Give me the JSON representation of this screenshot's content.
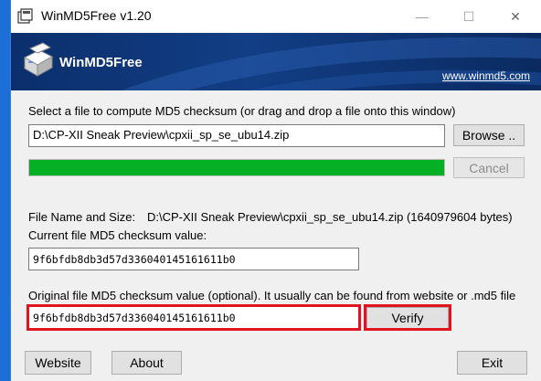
{
  "window": {
    "title": "WinMD5Free v1.20",
    "controls": {
      "minimize": "—",
      "maximize": "☐",
      "close": "✕"
    }
  },
  "banner": {
    "title": "WinMD5Free",
    "link": "www.winmd5.com"
  },
  "file_section": {
    "prompt": "Select a file to compute MD5 checksum (or drag and drop a file onto this window)",
    "path_value": "D:\\CP-XII Sneak Preview\\cpxii_sp_se_ubu14.zip",
    "browse_label": "Browse ..",
    "cancel_label": "Cancel",
    "progress": 1.0,
    "progress_color": "#06b025"
  },
  "info": {
    "name_size_label": "File Name and Size:",
    "name_size_value": "D:\\CP-XII Sneak Preview\\cpxii_sp_se_ubu14.zip (1640979604 bytes)",
    "current_md5_label": "Current file MD5 checksum value:",
    "current_md5_value": "9f6bfdb8db3d57d336040145161611b0"
  },
  "verify": {
    "label": "Original file MD5 checksum value (optional). It usually can be found from website or .md5 file",
    "value": "9f6bfdb8db3d57d336040145161611b0",
    "button_label": "Verify",
    "highlight_color": "#e0141e"
  },
  "footer": {
    "website_label": "Website",
    "about_label": "About",
    "exit_label": "Exit"
  }
}
